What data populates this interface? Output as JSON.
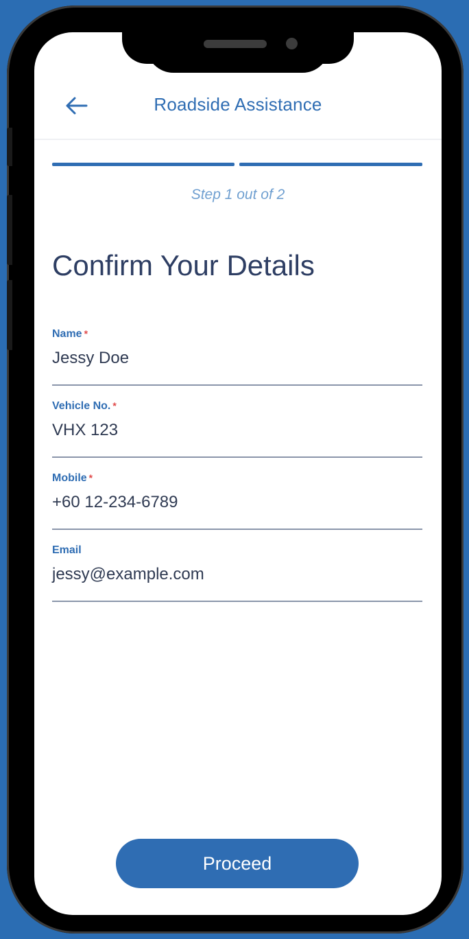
{
  "header": {
    "title": "Roadside Assistance",
    "back_icon": "arrow-left-icon"
  },
  "progress": {
    "step_text": "Step 1 out of 2",
    "current_step": 1,
    "total_steps": 2
  },
  "page_title": "Confirm Your Details",
  "fields": [
    {
      "label": "Name",
      "required_mark": "*",
      "value": "Jessy Doe"
    },
    {
      "label": "Vehicle No.",
      "required_mark": "*",
      "value": "VHX 123"
    },
    {
      "label": "Mobile",
      "required_mark": "*",
      "value": "+60 12-234-6789"
    },
    {
      "label": "Email",
      "required_mark": "",
      "value": "jessy@example.com"
    }
  ],
  "proceed_label": "Proceed",
  "colors": {
    "accent": "#2f6db3",
    "required": "#e04848",
    "title_text": "#2e3e63",
    "background": "#2b6db3"
  }
}
